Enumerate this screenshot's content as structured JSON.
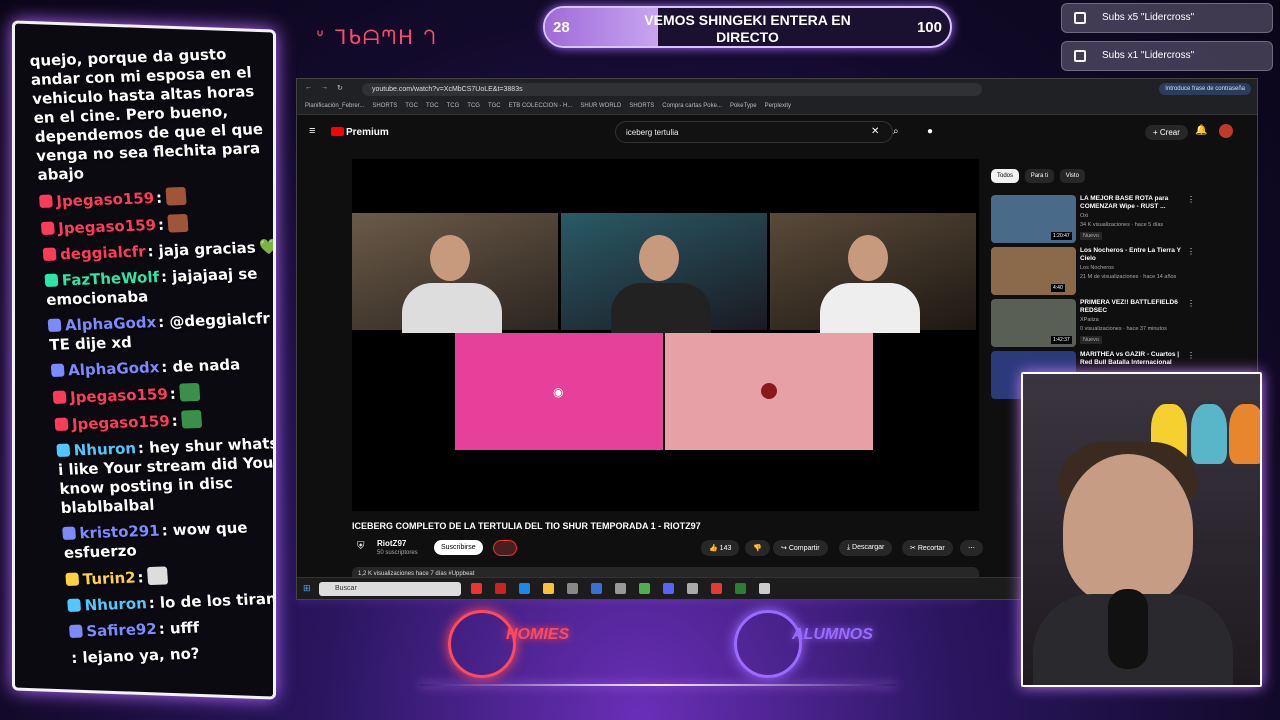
{
  "chat": {
    "messages": [
      {
        "user": "",
        "text": "quejo, porque da gusto andar con mi esposa en el vehiculo hasta altas horas en el cine. Pero bueno, dependemos de que el que venga no sea flechita para abajo",
        "color": "#ffffff"
      },
      {
        "user": "Jpegaso159",
        "text": ":",
        "color": "#ff3b5c",
        "emote": "#a0553a"
      },
      {
        "user": "Jpegaso159",
        "text": ":",
        "color": "#ff3b5c",
        "emote": "#a0553a"
      },
      {
        "user": "deggialcfr",
        "text": ": jaja gracias",
        "color": "#ff3b5c",
        "heart": "💚"
      },
      {
        "user": "FazTheWolf",
        "text": ": jajajaaj se emocionaba",
        "color": "#2ee6a8"
      },
      {
        "user": "AlphaGodx",
        "text": ": @deggialcfr TE dije xd",
        "color": "#7b8bff"
      },
      {
        "user": "AlphaGodx",
        "text": ": de nada",
        "color": "#7b8bff"
      },
      {
        "user": "Jpegaso159",
        "text": ":",
        "color": "#ff3b5c",
        "emote": "#3a8f4b"
      },
      {
        "user": "Jpegaso159",
        "text": ":",
        "color": "#ff3b5c",
        "emote": "#3a8f4b"
      },
      {
        "user": "Nhuron",
        "text": ": hey shur whatsap i like Your stream did You know posting in disc blablbalbal",
        "color": "#52c7ff"
      },
      {
        "user": "kristo291",
        "text": ": wow que esfuerzo",
        "color": "#7b8bff"
      },
      {
        "user": "Turin2",
        "text": ":",
        "color": "#ffd23f",
        "emote": "#dddddd"
      },
      {
        "user": "Nhuron",
        "text": ": lo de los tirantes",
        "color": "#52c7ff"
      },
      {
        "user": "Safire92",
        "text": ": ufff",
        "color": "#7b8bff"
      },
      {
        "user": "",
        "text": ": lejano ya, no?",
        "color": "#ffffff"
      }
    ]
  },
  "goal": {
    "current": "28",
    "target": "100",
    "title": "VEMOS SHINGEKI ENTERA EN DIRECTO",
    "progress": 0.28
  },
  "alerts": [
    {
      "text": "Subs x5 \"Lidercross\""
    },
    {
      "text": "Subs x1 \"Lidercross\""
    }
  ],
  "browser": {
    "url": "youtube.com/watch?v=XcMbCS7UoLE&t=3883s",
    "password_hint": "Introduce frase de contraseña",
    "bookmarks": [
      "Planificación_Febrer...",
      "SHORTS",
      "TGC",
      "TGC",
      "TCG",
      "TCG",
      "TGC",
      "ETB COLECCION - H...",
      "SHUR WORLD",
      "SHORTS",
      "Compra cartas Poke...",
      "PokeType",
      "Perplexity"
    ]
  },
  "youtube": {
    "logo": "Premium",
    "search": "iceberg tertulia",
    "create": "Crear",
    "video_title": "ICEBERG COMPLETO DE LA TERTULIA DEL TIO SHUR TEMPORADA 1 - RIOTZ97",
    "channel": "RiotZ97",
    "subs": "50 suscriptores",
    "subscribe": "Suscribirse",
    "likes": "143",
    "share": "Compartir",
    "download": "Descargar",
    "clip": "Recortar",
    "desc": "1,2 K visualizaciones  hace 7 días  #Uppbeat",
    "chips": [
      "Todos",
      "Para ti",
      "Visto"
    ],
    "recs": [
      {
        "title": "LA MEJOR BASE ROTA para COMENZAR Wipe - RUST ...",
        "channel": "Oxi",
        "meta": "34 K visualizaciones · hace 5 días",
        "badge": "Nuevo",
        "dur": "1:20:47",
        "thumb": "#4a6a8a"
      },
      {
        "title": "Los Nocheros - Entre La Tierra Y Cielo",
        "channel": "Los Nocheros",
        "meta": "21 M de visualizaciones · hace 14 años",
        "badge": "",
        "dur": "4:40",
        "thumb": "#8a6a4a"
      },
      {
        "title": "PRIMERA VEZ!! BATTLEFIELD6 REDSEC",
        "channel": "XPaiiza",
        "meta": "0 visualizaciones · hace 37 minutos",
        "badge": "Nuevo",
        "dur": "1:42:37",
        "thumb": "#5a5f55"
      },
      {
        "title": "MARITHEA vs GAZIR - Cuartos | Red Bull Batalla Internacional",
        "channel": "",
        "meta": "",
        "badge": "",
        "dur": "",
        "thumb": "#2a3a7a"
      }
    ]
  },
  "taskbar": {
    "search": "Buscar"
  },
  "logos": [
    {
      "text": "HOMIES",
      "color": "#ff4a5a"
    },
    {
      "text": "ALUMNOS",
      "color": "#9b6bff"
    }
  ],
  "deco_text": "ᐡ ᒣᑲᗩᘉᕼ ᘃ"
}
